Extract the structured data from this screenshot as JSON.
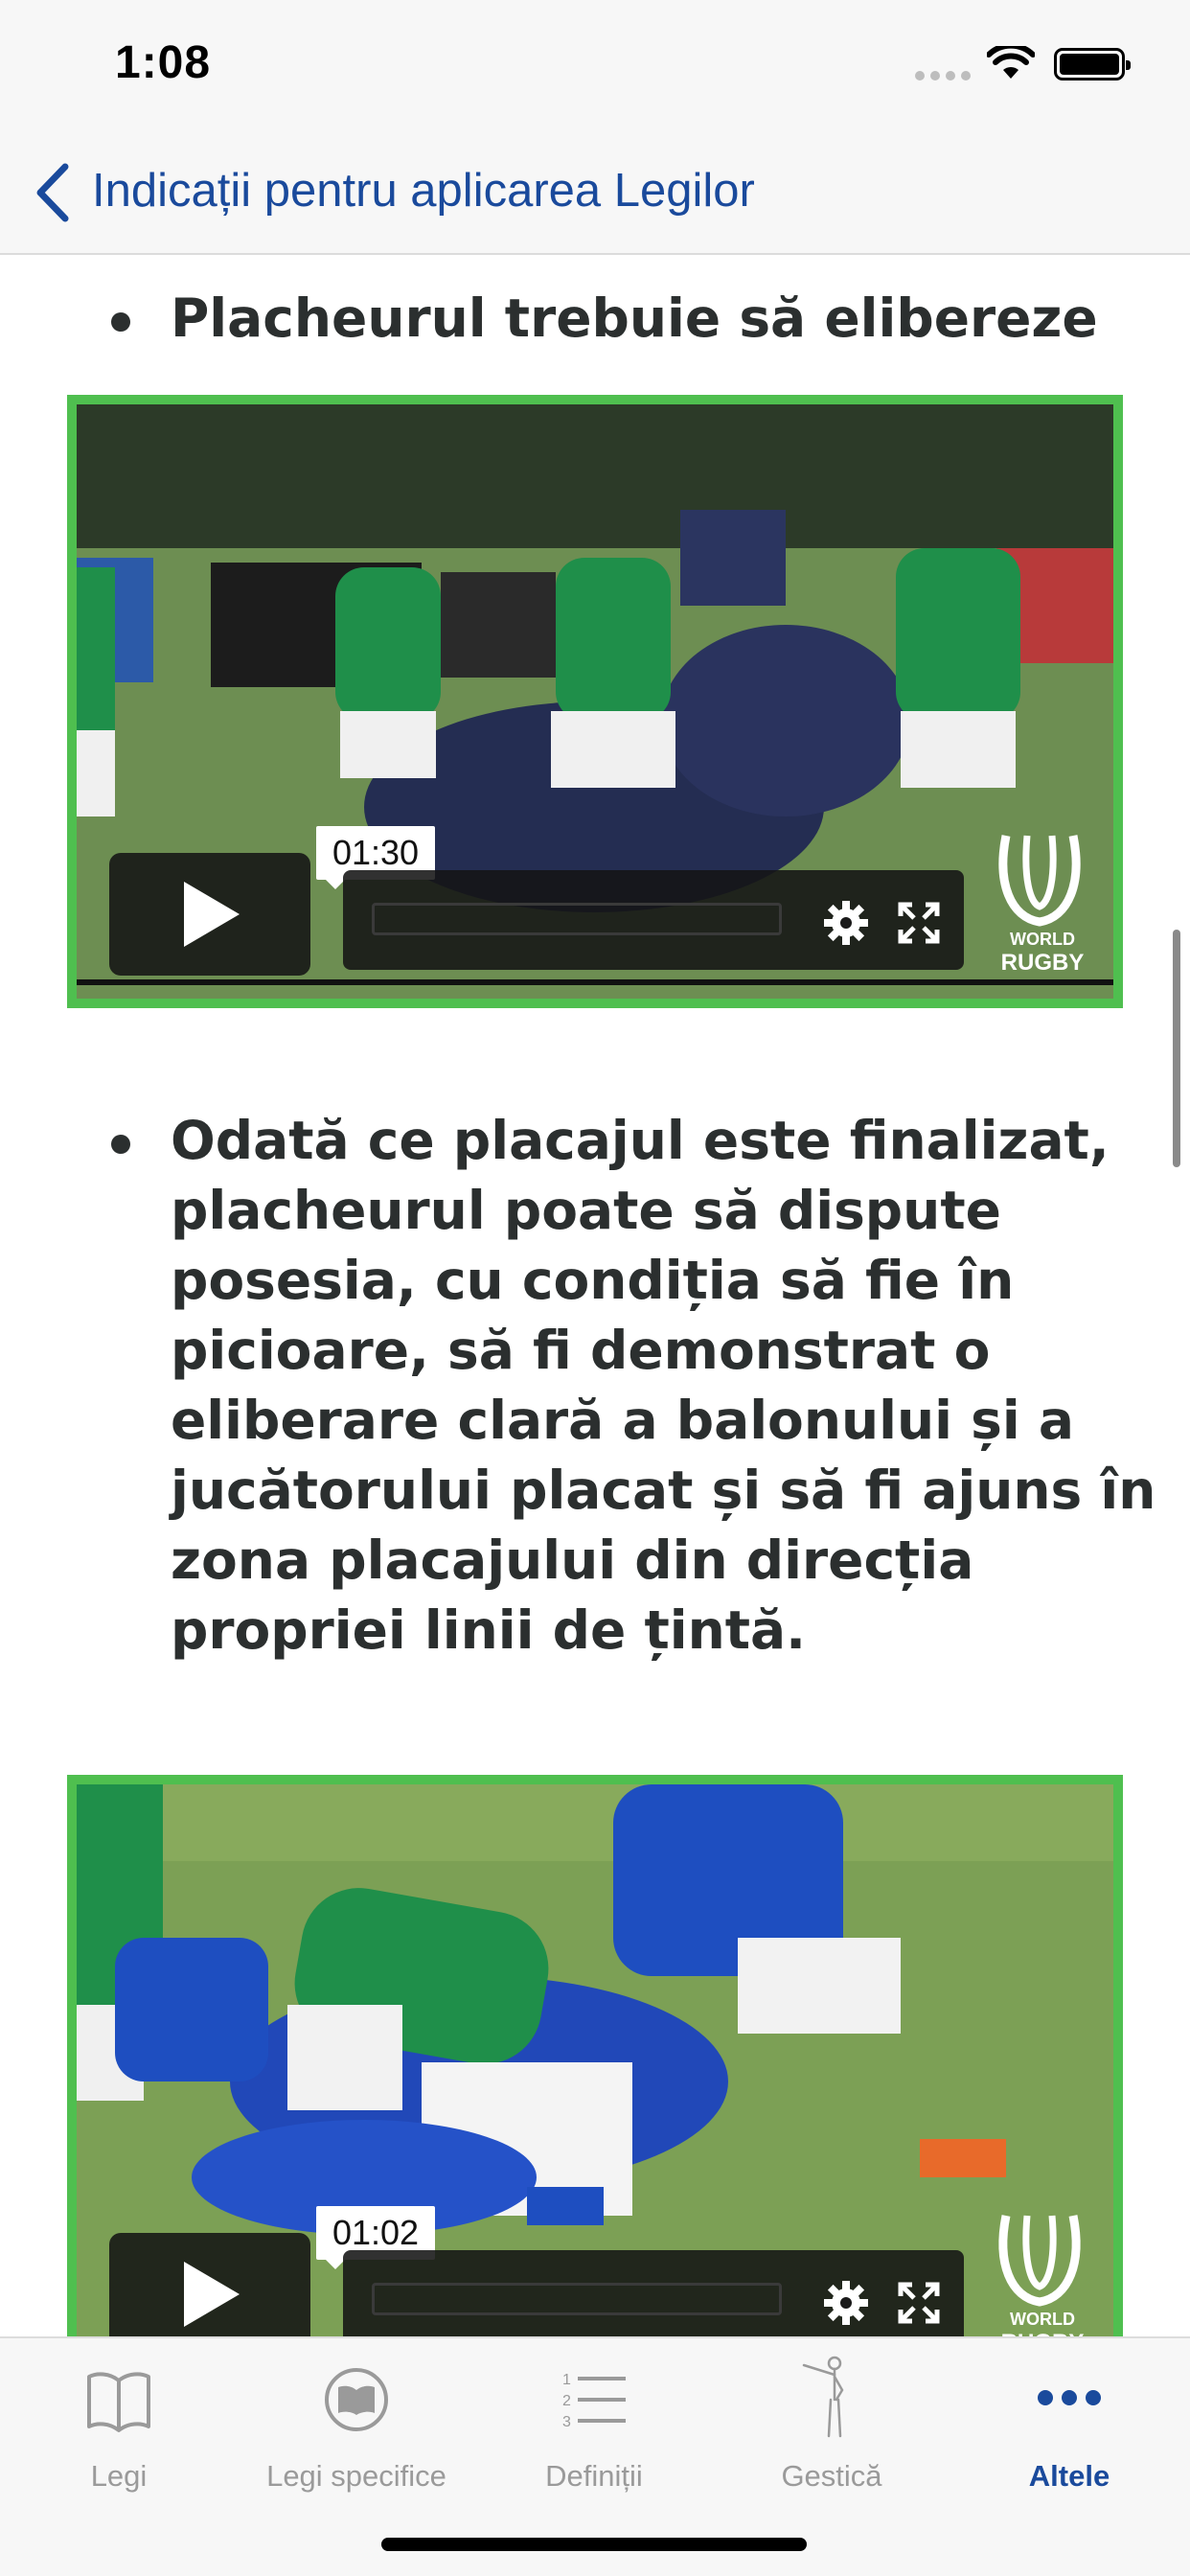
{
  "status_bar": {
    "time": "1:08"
  },
  "nav": {
    "title": "Indicații pentru aplicarea Legilor"
  },
  "content": {
    "bullets": [
      {
        "text": "Placheurul trebuie să elibereze"
      },
      {
        "text": "Odată ce placajul este finalizat, placheurul poate să dispute posesia, cu condiția să fie în picioare, să fi demonstrat o eliberare clară a balonului și a jucătorului placat și să fi ajuns în zona placajului din direcția propriei linii de țintă."
      }
    ],
    "videos": [
      {
        "time": "01:30",
        "logo_line1": "WORLD",
        "logo_line2": "RUGBY"
      },
      {
        "time": "01:02",
        "logo_line1": "WORLD",
        "logo_line2": "RUGBY"
      }
    ]
  },
  "tab_bar": {
    "tabs": [
      {
        "label": "Legi",
        "icon": "book-icon"
      },
      {
        "label": "Legi specifice",
        "icon": "book-circle-icon"
      },
      {
        "label": "Definiții",
        "icon": "numbered-list-icon"
      },
      {
        "label": "Gestică",
        "icon": "referee-signal-icon"
      },
      {
        "label": "Altele",
        "icon": "more-icon"
      }
    ],
    "active": "Altele"
  },
  "colors": {
    "accent": "#1a4a9c",
    "video_border": "#4fbf4f",
    "text": "#2b2f2f"
  }
}
